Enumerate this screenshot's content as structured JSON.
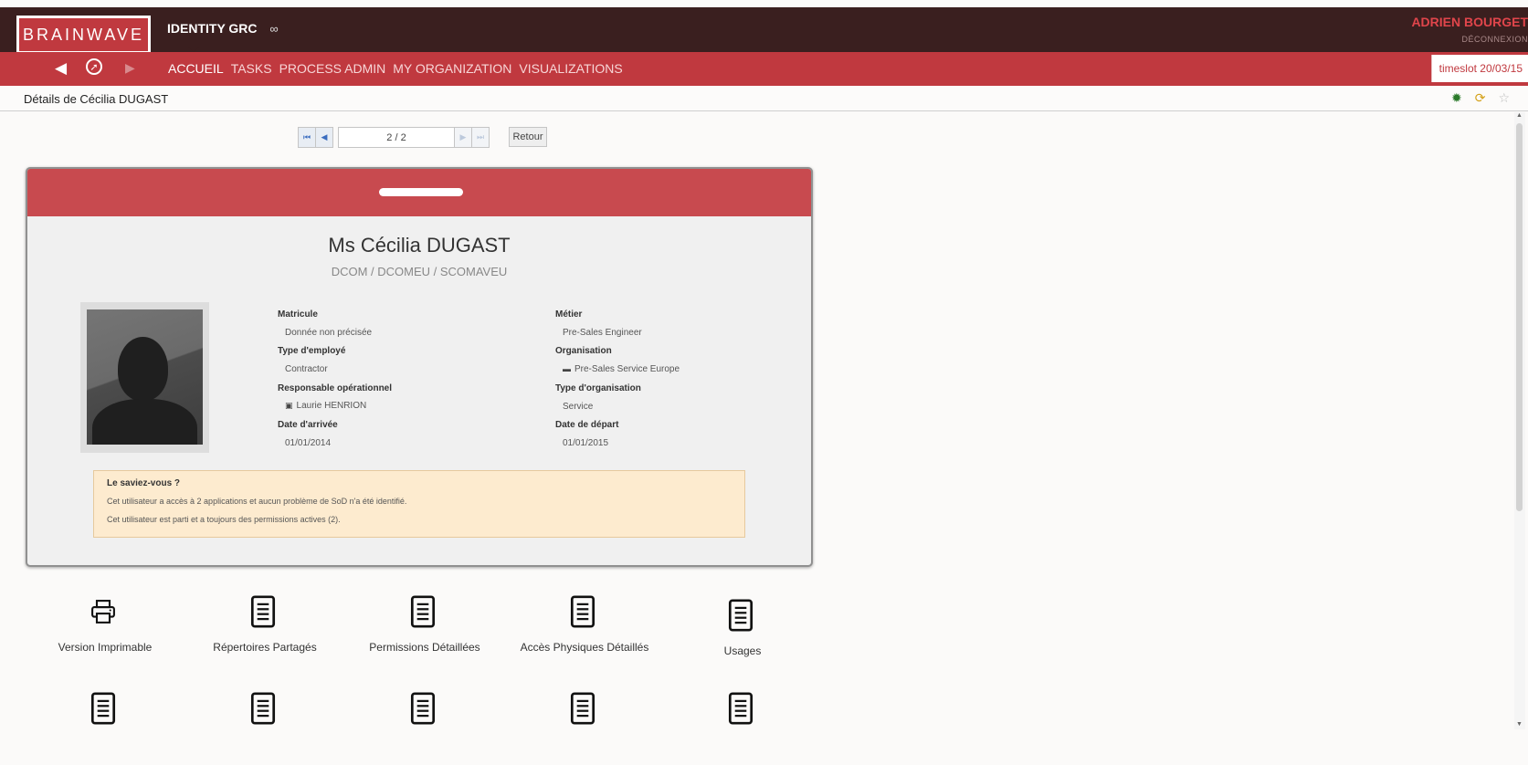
{
  "header": {
    "logo_text": "BRAINWAVE",
    "app_title": "IDENTITY GRC",
    "infinity_symbol": "∞",
    "user_name": "ADRIEN BOURGET",
    "logout_label": "DÉCONNEXION"
  },
  "nav": {
    "items": [
      "ACCUEIL",
      "TASKS",
      "PROCESS ADMIN",
      "MY ORGANIZATION",
      "VISUALIZATIONS"
    ],
    "active_index": 0,
    "timeslot": "timeslot 20/03/15"
  },
  "page": {
    "title": "Détails de Cécilia DUGAST"
  },
  "pager": {
    "position": "2 / 2",
    "back_label": "Retour"
  },
  "card": {
    "name": "Ms Cécilia DUGAST",
    "path": "DCOM / DCOMEU / SCOMAVEU",
    "fields_left": [
      {
        "label": "Matricule",
        "value": "Donnée non précisée"
      },
      {
        "label": "Type d'employé",
        "value": "Contractor"
      },
      {
        "label": "Responsable opérationnel",
        "value": "Laurie HENRION"
      },
      {
        "label": "Date d'arrivée",
        "value": "01/01/2014"
      }
    ],
    "fields_right": [
      {
        "label": "Métier",
        "value": "Pre-Sales Engineer"
      },
      {
        "label": "Organisation",
        "value": "Pre-Sales Service Europe"
      },
      {
        "label": "Type d'organisation",
        "value": "Service"
      },
      {
        "label": "Date de départ",
        "value": "01/01/2015"
      }
    ],
    "info": {
      "title": "Le saviez-vous ?",
      "lines": [
        "Cet utilisateur a accès à 2 applications et aucun problème de SoD n'a été identifié.",
        "Cet utilisateur est parti et a toujours des permissions actives (2)."
      ]
    }
  },
  "tiles": {
    "row1": [
      {
        "label": "Version Imprimable",
        "icon": "printer-icon"
      },
      {
        "label": "Répertoires Partagés",
        "icon": "document-icon"
      },
      {
        "label": "Permissions Détaillées",
        "icon": "document-icon"
      },
      {
        "label": "Accès Physiques Détaillés",
        "icon": "document-icon"
      },
      {
        "label": "Usages",
        "icon": "document-icon"
      }
    ],
    "row2_icons": [
      "document-icon",
      "document-icon",
      "document-icon",
      "document-icon",
      "document-icon"
    ]
  },
  "colors": {
    "topbar": "#3a1f1f",
    "brand_red": "#c0393f",
    "card_header": "#c84a4f",
    "info_bg": "#fdebcf"
  }
}
